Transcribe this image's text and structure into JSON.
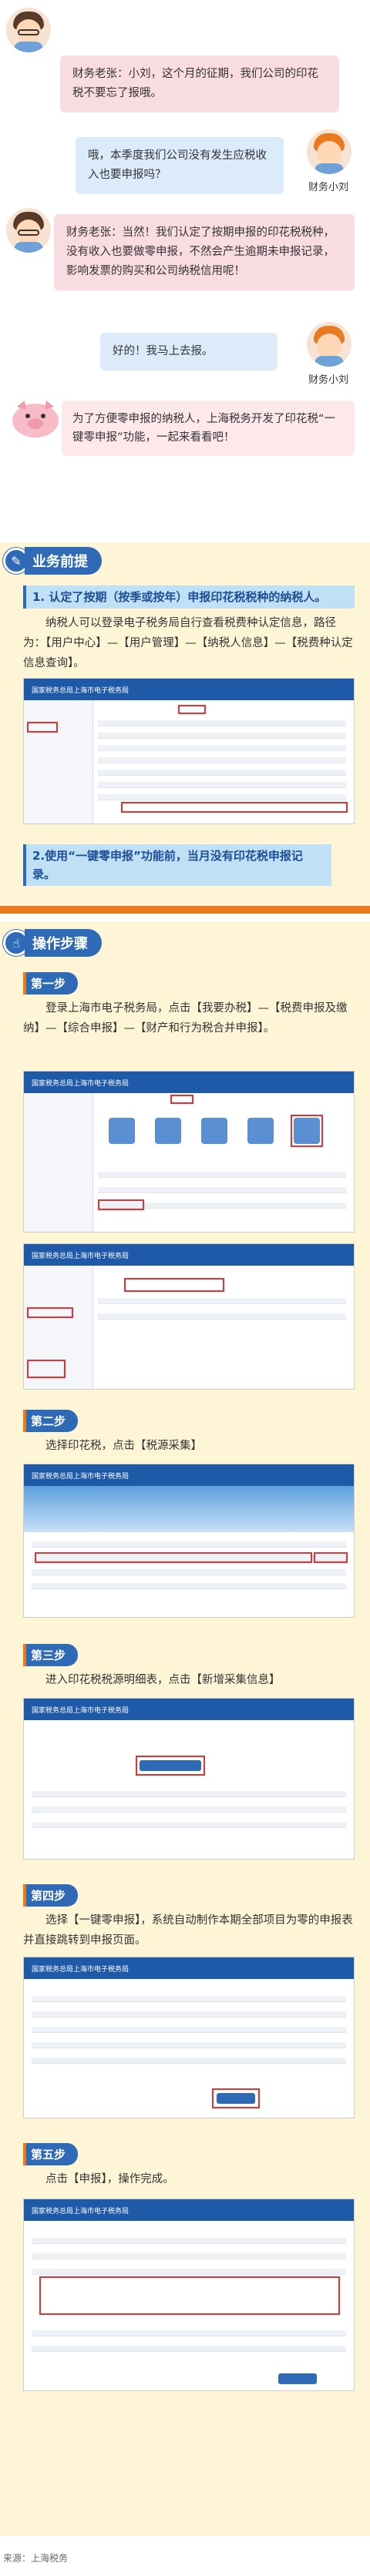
{
  "chat": [
    {
      "speaker": "财务老张",
      "text": "财务老张：小刘，这个月的征期，我们公司的印花税不要忘了报哦。"
    },
    {
      "speaker": "财务小刘",
      "text": "哦，本季度我们公司没有发生应税收入也要申报吗？",
      "name": "财务小刘"
    },
    {
      "speaker": "财务老张",
      "text": "财务老张：当然！我们认定了按期申报的印花税税种，没有收入也要做零申报，不然会产生逾期未申报记录，影响发票的购买和公司纳税信用呢！"
    },
    {
      "speaker": "财务小刘",
      "text": "好的！我马上去报。",
      "name": "财务小刘"
    }
  ],
  "intro": "为了方便零申报的纳税人，上海税务开发了印花税“一键零申报”功能，一起来看看吧！",
  "section1": {
    "title": "业务前提",
    "icon": "clipboard-icon",
    "point1": "1. 认定了按期（按季或按年）申报印花税税种的纳税人。",
    "para1": "纳税人可以登录电子税务局自行查看税费种认定信息，路径为：【用户中心】—【用户管理】—【纳税人信息】—【税费种认定信息查询】。",
    "point2": "2.使用“一键零申报”功能前，当月没有印花税申报记录。"
  },
  "section2": {
    "title": "操作步骤",
    "icon": "pointer-icon",
    "steps": [
      {
        "label": "第一步",
        "text": "登录上海市电子税务局，点击【我要办税】—【税费申报及缴纳】—【综合申报】—【财产和行为税合并申报】。"
      },
      {
        "label": "第二步",
        "text": "选择印花税，点击【税源采集】"
      },
      {
        "label": "第三步",
        "text": "进入印花税税源明细表，点击【新增采集信息】"
      },
      {
        "label": "第四步",
        "text": "选择【一键零申报】，系统自动制作本期全部项目为零的申报表并直接跳转到申报页面。"
      },
      {
        "label": "第五步",
        "text": "点击【申报】，操作完成。"
      }
    ]
  },
  "portal_title": "国家税务总局上海市电子税务局",
  "source": "来源：上海税务",
  "colors": {
    "accent": "#2f6ab7",
    "orange": "#e97a1f",
    "pink": "#f9dce2",
    "light_blue": "#dcebfa",
    "cream": "#fef5d6"
  }
}
